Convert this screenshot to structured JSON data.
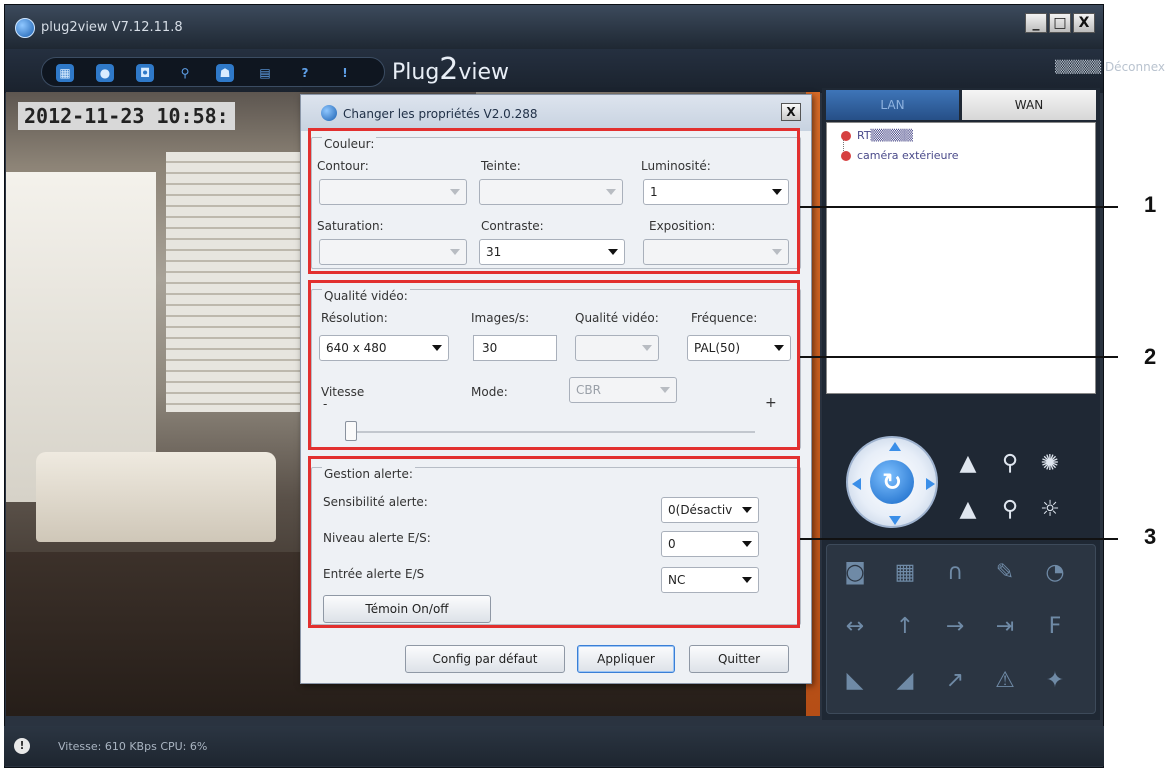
{
  "window": {
    "title": "plug2view  V7.12.11.8",
    "brand_prefix": "Plug",
    "brand_two": "2",
    "brand_suffix": "view",
    "user_info": "▒▒▒▒▒ Déconnex",
    "buttons": {
      "minimize": "_",
      "maximize": "□",
      "close": "X"
    }
  },
  "toolbar": {
    "icons": [
      "grid-icon",
      "camera-icon",
      "snapshot-icon",
      "search-icon",
      "user-icon",
      "save-icon",
      "help-icon",
      "info-icon"
    ]
  },
  "video": {
    "timestamp": "2012-11-23 10:58:"
  },
  "right_panel": {
    "tabs": [
      {
        "label": "LAN"
      },
      {
        "label": "WAN"
      }
    ],
    "tree": [
      {
        "label": "RT▒▒▒▒▒"
      },
      {
        "label": "caméra extérieure"
      }
    ]
  },
  "dialog": {
    "title": "Changer les propriétés V2.0.288",
    "close": "X",
    "couleur": {
      "title": "Couleur:",
      "contour_label": "Contour:",
      "teinte_label": "Teinte:",
      "luminosite_label": "Luminosité:",
      "luminosite_value": "1",
      "saturation_label": "Saturation:",
      "contraste_label": "Contraste:",
      "contraste_value": "31",
      "exposition_label": "Exposition:"
    },
    "video": {
      "title": "Qualité vidéo:",
      "resolution_label": "Résolution:",
      "resolution_value": "640 x 480",
      "images_label": "Images/s:",
      "images_value": "30",
      "qualite_label": "Qualité vidéo:",
      "frequence_label": "Fréquence:",
      "frequence_value": "PAL(50)",
      "vitesse_label": "Vitesse",
      "mode_label": "Mode:",
      "mode_value": "CBR",
      "minus": "-",
      "plus": "+",
      "vitesse_level": 0.0
    },
    "alerte": {
      "title": "Gestion alerte:",
      "sensibilite_label": "Sensibilité alerte:",
      "sensibilite_value": "0(Désactiv",
      "niveau_label": "Niveau alerte E/S:",
      "niveau_value": "0",
      "entree_label": "Entrée alerte E/S",
      "entree_value": "NC",
      "temoin_button": "Témoin On/off"
    },
    "buttons": {
      "defaut": "Config par défaut",
      "appliquer": "Appliquer",
      "quitter": "Quitter"
    }
  },
  "callouts": [
    "1",
    "2",
    "3"
  ],
  "status": {
    "icon": "!",
    "text": "Vitesse: 610 KBps  CPU:   6%"
  },
  "colors": {
    "highlight_box": "#e2302f",
    "app_background": "#2a3340"
  }
}
